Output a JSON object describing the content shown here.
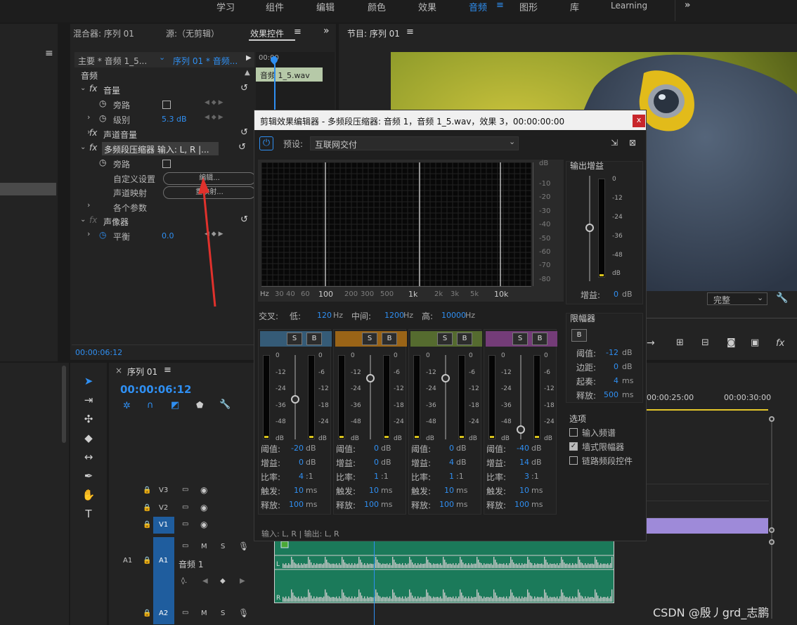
{
  "workspaces": [
    "学习",
    "组件",
    "编辑",
    "颜色",
    "效果",
    "音频",
    "图形",
    "库",
    "Learning"
  ],
  "active_workspace_index": 5,
  "tabs_left": {
    "mixer": "混合器: 序列 01",
    "source": "源:（无剪辑）",
    "effect_controls": "效果控件"
  },
  "program_tab": "节目: 序列 01",
  "ec": {
    "master": "主要 * 音频 1_5...",
    "sequence": "序列 01 * 音频...",
    "ruler_time": "00:00",
    "clip": "音频 1_5.wav",
    "section": "音频",
    "volume": "音量",
    "bypass": "旁路",
    "level": "级别",
    "level_value": "5.3 dB",
    "channel_volume": "声道音量",
    "mbc": "多频段压缩器 输入: L, R |...",
    "custom": "自定义设置",
    "edit_btn": "编辑...",
    "channel_map": "声道映射",
    "remap_btn": "重映射...",
    "params": "各个参数",
    "panner": "声像器",
    "balance": "平衡",
    "balance_value": "0.0",
    "timecode": "00:00:06:12"
  },
  "timeline": {
    "tab": "序列 01",
    "timecode": "00:00:06:12",
    "tracks": [
      {
        "label": "V3"
      },
      {
        "label": "V2"
      },
      {
        "label": "V1"
      },
      {
        "label": "A1",
        "name": "音频 1"
      },
      {
        "label": "A2"
      }
    ],
    "ruler": [
      "00:00:25:00",
      "00:00:30:00"
    ]
  },
  "dialog": {
    "title": "剪辑效果编辑器 - 多频段压缩器: 音频 1，音频 1_5.wav，效果 3，00:00:00:00",
    "close": "x",
    "preset_label": "预设:",
    "preset_value": "互联网交付",
    "db_axis": [
      "dB",
      "-10",
      "-20",
      "-30",
      "-40",
      "-50",
      "-60",
      "-70",
      "-80"
    ],
    "hz_axis": [
      "Hz",
      "30",
      "40",
      "60",
      "100",
      "200",
      "300",
      "500",
      "1k",
      "2k",
      "3k",
      "5k",
      "10k"
    ],
    "crossover": {
      "label": "交叉:",
      "low_label": "低:",
      "low": "120",
      "mid_label": "中间:",
      "mid": "1200",
      "high_label": "高:",
      "high": "10000",
      "unit": "Hz"
    },
    "band_scale_left": [
      "0",
      "-12",
      "-24",
      "-36",
      "-48",
      "dB"
    ],
    "band_scale_right": [
      "0",
      "-6",
      "-12",
      "-18",
      "-24",
      "dB"
    ],
    "band_colors": [
      "#355b77",
      "#9a6417",
      "#556b2f",
      "#743c78"
    ],
    "solo": "S",
    "bypass": "B",
    "param_labels": [
      "阈值:",
      "增益:",
      "比率:",
      "触发:",
      "释放:"
    ],
    "bands": [
      {
        "threshold": "-20",
        "gain": "0",
        "ratio": "4",
        "attack": "10",
        "release": "100"
      },
      {
        "threshold": "0",
        "gain": "0",
        "ratio": "1",
        "attack": "10",
        "release": "100"
      },
      {
        "threshold": "0",
        "gain": "4",
        "ratio": "1",
        "attack": "10",
        "release": "100"
      },
      {
        "threshold": "-40",
        "gain": "14",
        "ratio": "3",
        "attack": "10",
        "release": "100"
      }
    ],
    "units": {
      "db": "dB",
      "ratio": ":1",
      "ms": "ms"
    },
    "output_gain": {
      "title": "输出增益",
      "scale": [
        "0",
        "-12",
        "-24",
        "-36",
        "-48",
        "dB"
      ],
      "gain_label": "增益:",
      "gain_value": "0",
      "unit": "dB"
    },
    "limiter": {
      "title": "限幅器",
      "bypass": "B",
      "threshold_label": "阈值:",
      "threshold": "-12",
      "margin_label": "边距:",
      "margin": "0",
      "attack_label": "起奏:",
      "attack": "4",
      "release_label": "释放:",
      "release": "500"
    },
    "options": {
      "title": "选项",
      "spectrum": "输入频谱",
      "brickwall": "墙式限幅器",
      "link": "链路频段控件"
    },
    "footer": "输入: L, R | 输出: L, R"
  },
  "watermark": "CSDN @殷丿grd_志鹏",
  "program_quality": "完整"
}
